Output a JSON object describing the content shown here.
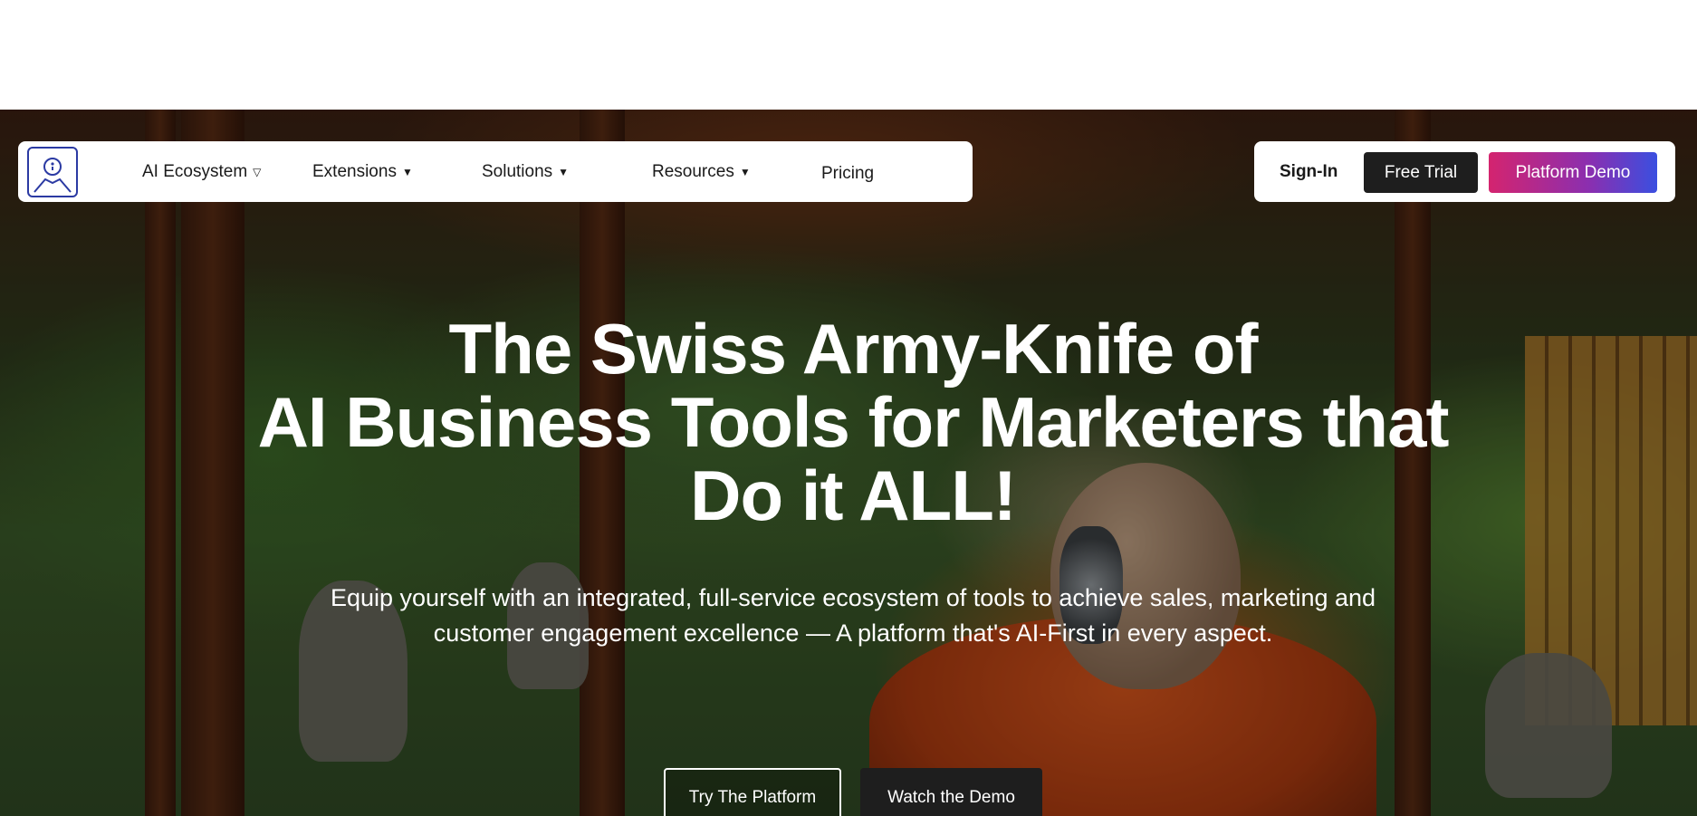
{
  "nav": {
    "logo_icon": "user-avatar-icon",
    "items": [
      {
        "label": "AI Ecosystem",
        "caret": "▽"
      },
      {
        "label": "Extensions",
        "caret": "▼"
      },
      {
        "label": "Solutions",
        "caret": "▼"
      },
      {
        "label": "Resources",
        "caret": "▼"
      },
      {
        "label": "Pricing"
      }
    ],
    "sign_in": "Sign-In",
    "free_trial": "Free Trial",
    "platform_demo": "Platform Demo"
  },
  "hero": {
    "headline_lines": [
      "The Swiss Army-Knife of",
      "AI Business Tools for Marketers that",
      "Do it ALL!"
    ],
    "subtext_lines": [
      "Equip yourself with an integrated, full-service ecosystem of tools to achieve sales, marketing and",
      "customer engagement excellence — A platform that's AI-First in every aspect."
    ],
    "try_button": "Try The Platform",
    "watch_button": "Watch the Demo"
  },
  "colors": {
    "demo_gradient_start": "#d4246f",
    "demo_gradient_end": "#3a4fe0",
    "dark_button": "#1e1e1e",
    "logo_stroke": "#2b3aa3"
  }
}
